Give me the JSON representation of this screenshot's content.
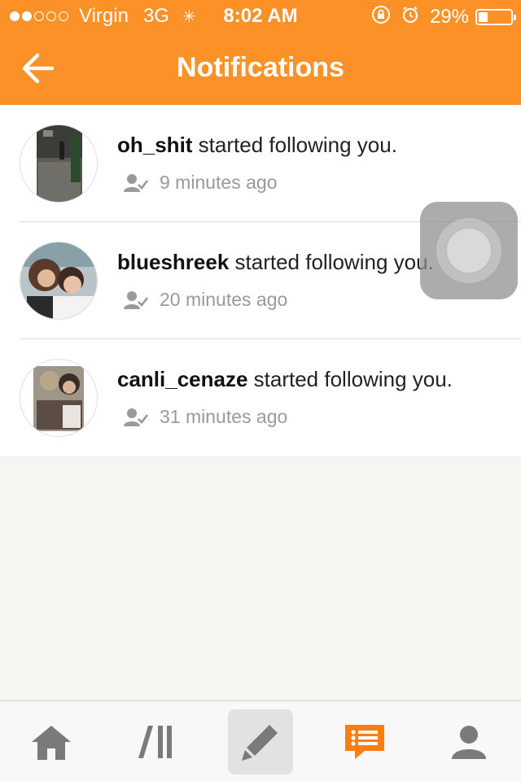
{
  "status_bar": {
    "carrier": "Virgin",
    "network": "3G",
    "time": "8:02 AM",
    "battery": "29%",
    "battery_level": 0.29,
    "signal_bars_filled": 2,
    "signal_bars_total": 5
  },
  "header": {
    "title": "Notifications",
    "back_icon": "arrow-left-icon"
  },
  "notifications": [
    {
      "username": "oh_shit",
      "action": " started following you.",
      "time": "9 minutes ago",
      "icon": "user-check-icon"
    },
    {
      "username": "blueshreek",
      "action": " started following you.",
      "time": "20 minutes ago",
      "icon": "user-check-icon"
    },
    {
      "username": "canli_cenaze",
      "action": " started following you.",
      "time": "31 minutes ago",
      "icon": "user-check-icon"
    }
  ],
  "tab_bar": {
    "tabs": [
      {
        "icon": "home-icon"
      },
      {
        "icon": "library-icon"
      },
      {
        "icon": "compose-icon"
      },
      {
        "icon": "notifications-icon"
      },
      {
        "icon": "profile-icon"
      }
    ]
  },
  "colors": {
    "brand": "#fc9127",
    "tab_icon": "#7a7a7a",
    "tab_active": "#fc7e12"
  }
}
